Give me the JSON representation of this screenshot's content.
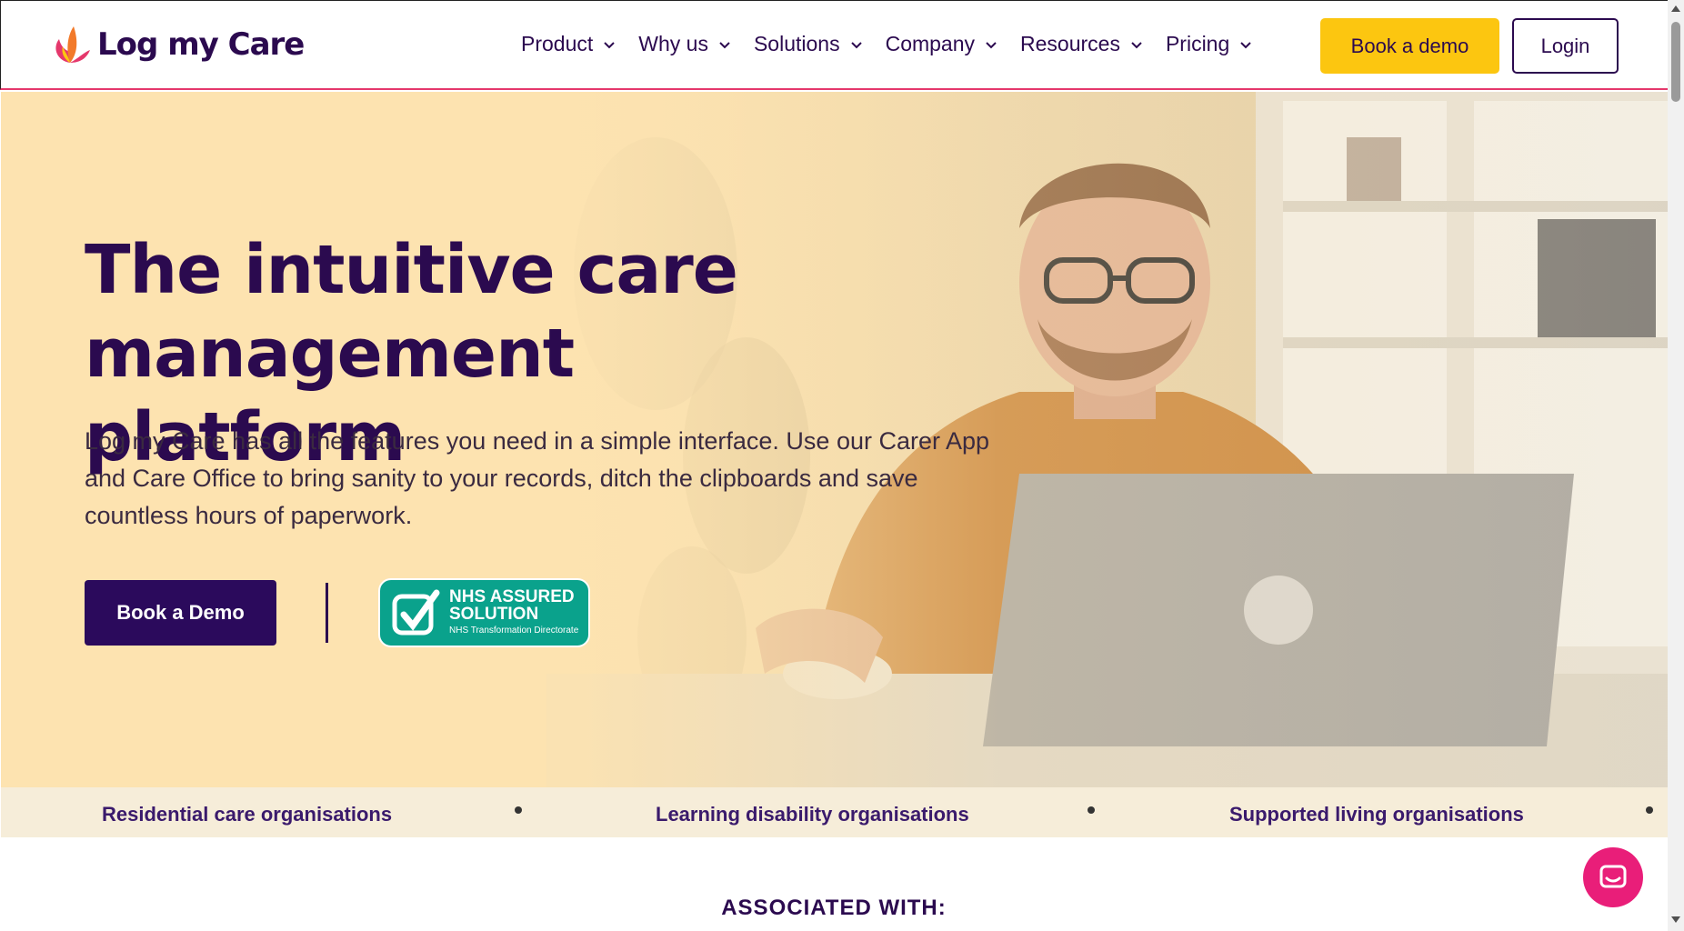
{
  "brand": {
    "name": "Log my Care",
    "accent": "#fcc610",
    "primary": "#2b0a5c",
    "pink": "#e5386c"
  },
  "nav": {
    "items": [
      {
        "label": "Product"
      },
      {
        "label": "Why us"
      },
      {
        "label": "Solutions"
      },
      {
        "label": "Company"
      },
      {
        "label": "Resources"
      },
      {
        "label": "Pricing"
      }
    ],
    "book_demo_label": "Book a demo",
    "login_label": "Login"
  },
  "hero": {
    "title_line1": "The intuitive care",
    "title_line2": "management platform",
    "subtitle_line1": "Log my Care has all the features you need in a simple interface. Use our Carer App",
    "subtitle_line2": "and Care Office to bring sanity to your records, ditch the clipboards and save",
    "subtitle_line3": "countless hours of paperwork.",
    "cta_label": "Book a Demo",
    "badge": {
      "line1": "NHS ASSURED",
      "line2": "SOLUTION",
      "line3": "NHS Transformation Directorate"
    }
  },
  "ticker": {
    "items": [
      "Residential care organisations",
      "Learning disability organisations",
      "Supported living organisations"
    ]
  },
  "associated_heading": "ASSOCIATED WITH:"
}
